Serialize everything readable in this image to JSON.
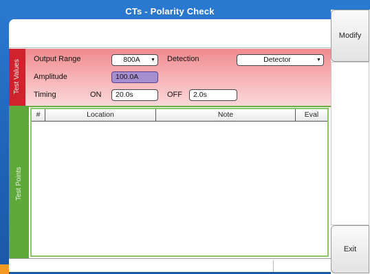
{
  "window": {
    "title": "CTs - Polarity Check"
  },
  "sidebar_buttons": {
    "modify": "Modify",
    "exit": "Exit"
  },
  "test_values": {
    "tab_label": "Test Values",
    "output_range_label": "Output Range",
    "output_range_value": "800A",
    "detection_label": "Detection",
    "detection_value": "Detector",
    "amplitude_label": "Amplitude",
    "amplitude_value": "100.0A",
    "timing_label": "Timing",
    "on_label": "ON",
    "on_value": "20.0s",
    "off_label": "OFF",
    "off_value": "2.0s"
  },
  "test_points": {
    "tab_label": "Test Points",
    "columns": [
      "#",
      "Location",
      "Note",
      "Eval"
    ],
    "rows": []
  },
  "colors": {
    "frame_blue": "#2b7ad1",
    "test_values_red": "#d0222c",
    "test_points_green": "#5fa93a",
    "amplitude_purple": "#a68fd0",
    "corner_orange": "#f39a22"
  },
  "icons": {
    "dropdown": "triangle-down-icon"
  }
}
